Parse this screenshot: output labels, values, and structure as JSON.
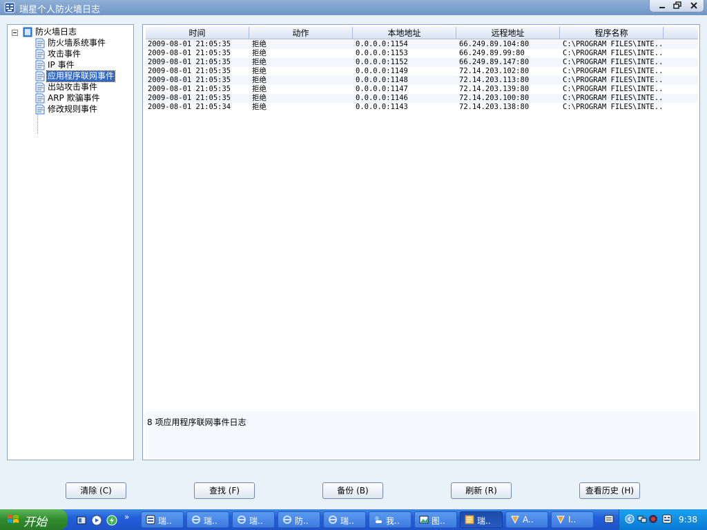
{
  "window": {
    "title": "瑞星个人防火墙日志"
  },
  "tree": {
    "root": "防火墙日志",
    "items": [
      {
        "label": "防火墙系统事件",
        "selected": false
      },
      {
        "label": "攻击事件",
        "selected": false
      },
      {
        "label": "IP 事件",
        "selected": false
      },
      {
        "label": "应用程序联网事件",
        "selected": true
      },
      {
        "label": "出站攻击事件",
        "selected": false
      },
      {
        "label": "ARP 欺骗事件",
        "selected": false
      },
      {
        "label": "修改规则事件",
        "selected": false
      }
    ]
  },
  "table": {
    "columns": [
      "时间",
      "动作",
      "本地地址",
      "远程地址",
      "程序名称"
    ],
    "rows": [
      [
        "2009-08-01 21:05:35",
        "拒绝",
        "0.0.0.0:1154",
        "66.249.89.104:80",
        "C:\\PROGRAM FILES\\INTE..."
      ],
      [
        "2009-08-01 21:05:35",
        "拒绝",
        "0.0.0.0:1153",
        "66.249.89.99:80",
        "C:\\PROGRAM FILES\\INTE..."
      ],
      [
        "2009-08-01 21:05:35",
        "拒绝",
        "0.0.0.0:1152",
        "66.249.89.147:80",
        "C:\\PROGRAM FILES\\INTE..."
      ],
      [
        "2009-08-01 21:05:35",
        "拒绝",
        "0.0.0.0:1149",
        "72.14.203.102:80",
        "C:\\PROGRAM FILES\\INTE..."
      ],
      [
        "2009-08-01 21:05:35",
        "拒绝",
        "0.0.0.0:1148",
        "72.14.203.113:80",
        "C:\\PROGRAM FILES\\INTE..."
      ],
      [
        "2009-08-01 21:05:35",
        "拒绝",
        "0.0.0.0:1147",
        "72.14.203.139:80",
        "C:\\PROGRAM FILES\\INTE..."
      ],
      [
        "2009-08-01 21:05:35",
        "拒绝",
        "0.0.0.0:1146",
        "72.14.203.100:80",
        "C:\\PROGRAM FILES\\INTE..."
      ],
      [
        "2009-08-01 21:05:34",
        "拒绝",
        "0.0.0.0:1143",
        "72.14.203.138:80",
        "C:\\PROGRAM FILES\\INTE..."
      ]
    ]
  },
  "status": {
    "text": "8 项应用程序联网事件日志"
  },
  "buttons": {
    "clear": "清除 (C)",
    "find": "查找 (F)",
    "backup": "备份 (B)",
    "refresh": "刷新 (R)",
    "history": "查看历史 (H)"
  },
  "taskbar": {
    "start": "开始",
    "tasks": [
      {
        "label": "瑞..",
        "icon": "firewall-icon",
        "active": false
      },
      {
        "label": "瑞..",
        "icon": "ie-icon",
        "active": false
      },
      {
        "label": "瑞..",
        "icon": "ie-icon",
        "active": false
      },
      {
        "label": "防..",
        "icon": "ie-icon",
        "active": false
      },
      {
        "label": "瑞..",
        "icon": "ie-icon",
        "active": false
      },
      {
        "label": "我..",
        "icon": "chat-icon",
        "active": false
      },
      {
        "label": "图..",
        "icon": "picture-icon",
        "active": false
      },
      {
        "label": "瑞..",
        "icon": "log-icon",
        "active": true
      },
      {
        "label": "A..",
        "icon": "app-icon",
        "active": false
      },
      {
        "label": "I..",
        "icon": "app-icon",
        "active": false
      }
    ],
    "clock": "9:38"
  },
  "colors": {
    "accent": "#316ac5",
    "panel_border": "#8aa4c8",
    "background": "#e9f1f9"
  }
}
